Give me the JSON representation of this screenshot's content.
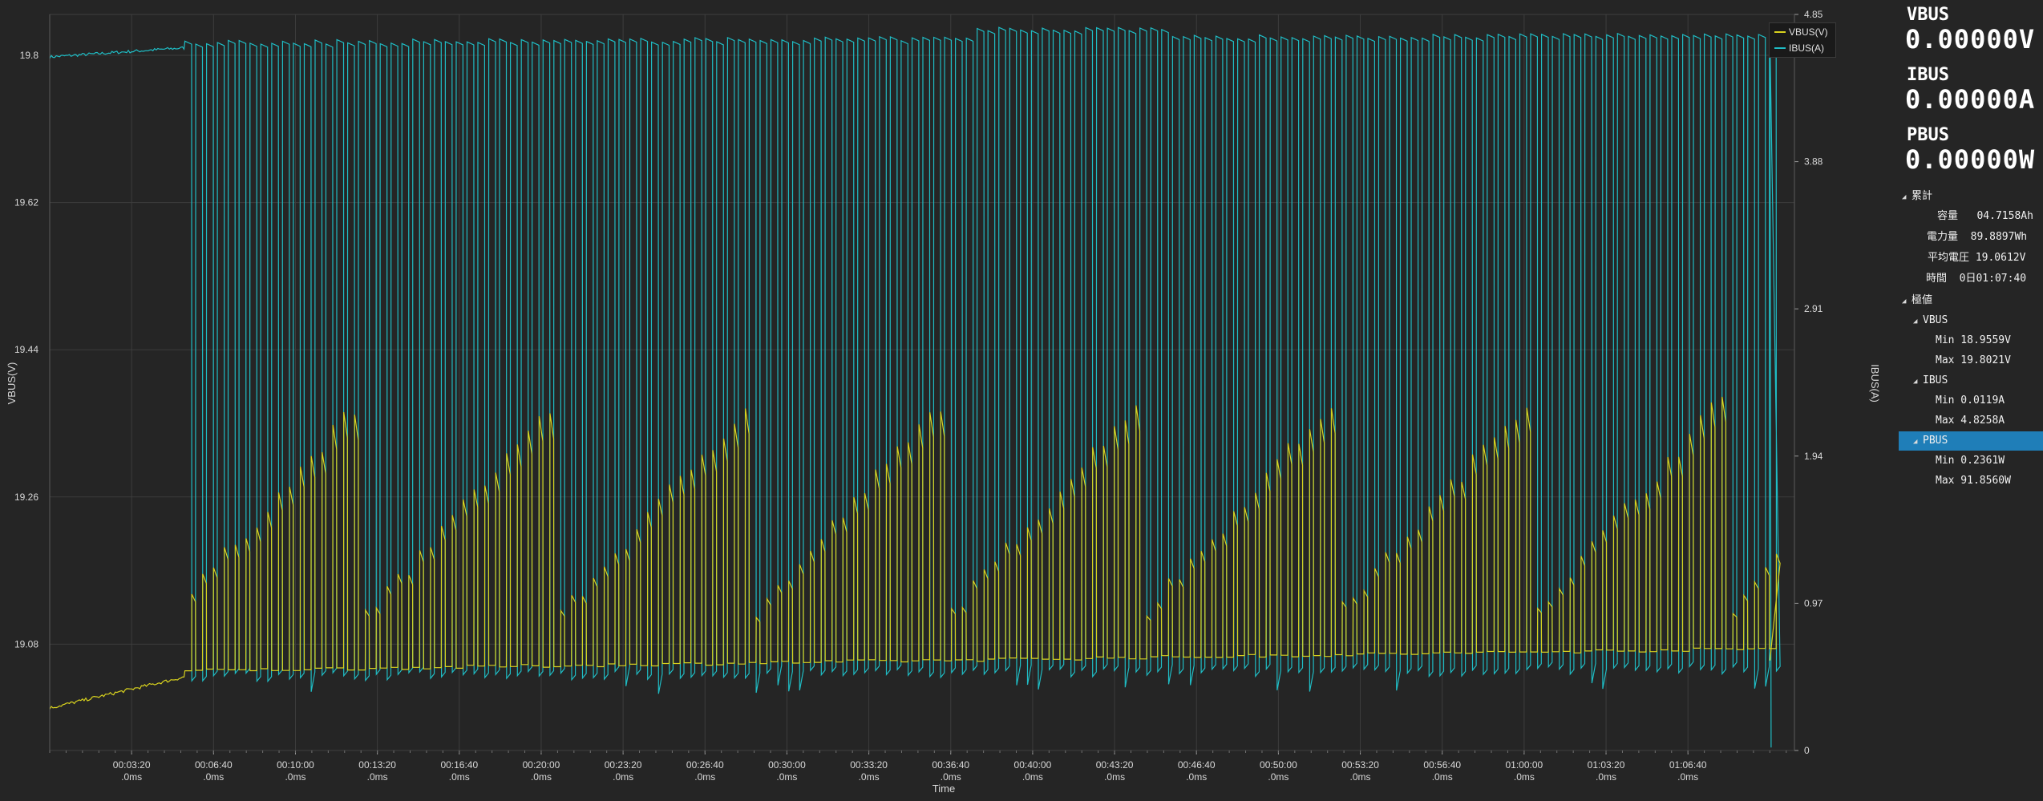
{
  "chart_data": {
    "type": "line",
    "xlabel": "Time",
    "ylabel_left": "VBUS(V)",
    "ylabel_right": "IBUS(A)",
    "y_left_ticks": [
      "19.8",
      "19.62",
      "19.44",
      "19.26",
      "19.08"
    ],
    "y_left_tick_values": [
      19.8,
      19.62,
      19.44,
      19.26,
      19.08
    ],
    "y_left_range": [
      18.95,
      19.85
    ],
    "y_right_ticks": [
      "4.85",
      "3.88",
      "2.91",
      "1.94",
      "0.97",
      "0"
    ],
    "y_right_tick_values": [
      4.85,
      3.88,
      2.91,
      1.94,
      0.97,
      0
    ],
    "y_right_range": [
      0,
      4.85
    ],
    "x_range_seconds": [
      0,
      4260
    ],
    "x_ticks": [
      {
        "t": "00:03:20",
        "sub": ".0ms",
        "sec": 200
      },
      {
        "t": "00:06:40",
        "sub": ".0ms",
        "sec": 400
      },
      {
        "t": "00:10:00",
        "sub": ".0ms",
        "sec": 600
      },
      {
        "t": "00:13:20",
        "sub": ".0ms",
        "sec": 800
      },
      {
        "t": "00:16:40",
        "sub": ".0ms",
        "sec": 1000
      },
      {
        "t": "00:20:00",
        "sub": ".0ms",
        "sec": 1200
      },
      {
        "t": "00:23:20",
        "sub": ".0ms",
        "sec": 1400
      },
      {
        "t": "00:26:40",
        "sub": ".0ms",
        "sec": 1600
      },
      {
        "t": "00:30:00",
        "sub": ".0ms",
        "sec": 1800
      },
      {
        "t": "00:33:20",
        "sub": ".0ms",
        "sec": 2000
      },
      {
        "t": "00:36:40",
        "sub": ".0ms",
        "sec": 2200
      },
      {
        "t": "00:40:00",
        "sub": ".0ms",
        "sec": 2400
      },
      {
        "t": "00:43:20",
        "sub": ".0ms",
        "sec": 2600
      },
      {
        "t": "00:46:40",
        "sub": ".0ms",
        "sec": 2800
      },
      {
        "t": "00:50:00",
        "sub": ".0ms",
        "sec": 3000
      },
      {
        "t": "00:53:20",
        "sub": ".0ms",
        "sec": 3200
      },
      {
        "t": "00:56:40",
        "sub": ".0ms",
        "sec": 3400
      },
      {
        "t": "01:00:00",
        "sub": ".0ms",
        "sec": 3600
      },
      {
        "t": "01:03:20",
        "sub": ".0ms",
        "sec": 3800
      },
      {
        "t": "01:06:40",
        "sub": ".0ms",
        "sec": 4000
      }
    ],
    "series": [
      {
        "name": "VBUS(V)",
        "axis": "left",
        "color": "#d8d21e",
        "description": "rises from 19.0 to 19.04 V; after ~00:05:30 oscillates between ~19.03 and ~19.3 V in sawtooth peaks"
      },
      {
        "name": "IBUS(A)",
        "axis": "right",
        "color": "#1fbcc4",
        "description": "~4.6 A until ~00:05:30, then rapid pulses between ~0.45 and ~4.75 A"
      }
    ],
    "grid": true,
    "legend_placement": "top-right"
  },
  "colors": {
    "background": "#252525",
    "vbus": "#d8d21e",
    "ibus": "#1fbcc4",
    "grid": "#3d3d3d",
    "selected": "#1f7eb8"
  },
  "side": {
    "vbus_label": "VBUS",
    "vbus_value": "0.00000V",
    "ibus_label": "IBUS",
    "ibus_value": "0.00000A",
    "pbus_label": "PBUS",
    "pbus_value": "0.00000W",
    "cumulative": {
      "header": "累計",
      "items": [
        {
          "key": "容量",
          "value": "04.7158Ah"
        },
        {
          "key": "電力量",
          "value": "89.8897Wh"
        },
        {
          "key": "平均電圧",
          "value": "19.0612V"
        },
        {
          "key": "時間",
          "value": "0日01:07:40"
        }
      ]
    },
    "extremes": {
      "header": "極値",
      "groups": [
        {
          "name": "VBUS",
          "min": "Min 18.9559V",
          "max": "Max 19.8021V"
        },
        {
          "name": "IBUS",
          "min": "Min 0.0119A",
          "max": "Max 4.8258A"
        },
        {
          "name": "PBUS",
          "min": "Min 0.2361W",
          "max": "Max 91.8560W"
        }
      ]
    }
  }
}
